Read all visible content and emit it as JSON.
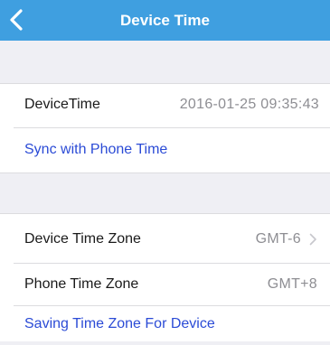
{
  "header": {
    "title": "Device Time",
    "bg_color": "#3f9fe0",
    "back_icon": "chevron-left-icon"
  },
  "device_time_section": {
    "device_time_label": "DeviceTime",
    "device_time_value": "2016-01-25  09:35:43",
    "sync_action": "Sync with Phone Time"
  },
  "timezone_section": {
    "device_tz_label": "Device Time Zone",
    "device_tz_value": "GMT-6",
    "device_tz_icon": "chevron-right-icon",
    "phone_tz_label": "Phone Time Zone",
    "phone_tz_value": "GMT+8",
    "save_action": "Saving Time Zone For Device"
  },
  "colors": {
    "link": "#2b4bd6",
    "background": "#efeff4"
  }
}
